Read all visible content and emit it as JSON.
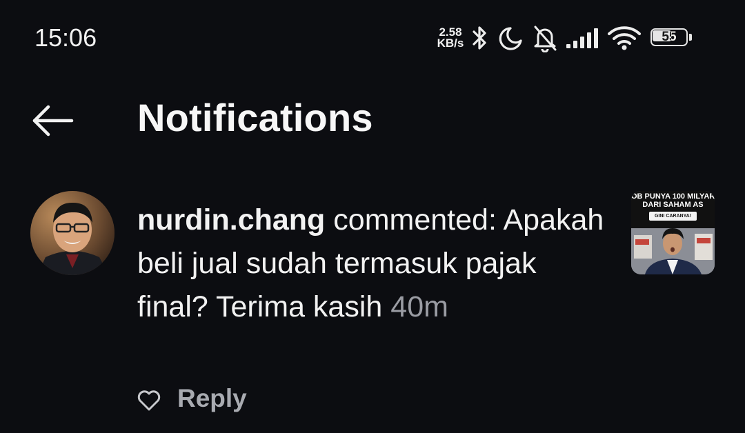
{
  "status_bar": {
    "time": "15:06",
    "net_speed_value": "2.58",
    "net_speed_unit": "KB/s",
    "battery_level": "55",
    "icons": [
      "bluetooth-icon",
      "moon-icon",
      "bell-muted-icon",
      "signal-icon",
      "wifi-icon",
      "battery-icon"
    ]
  },
  "header": {
    "title": "Notifications",
    "back_icon": "arrow-left-icon"
  },
  "notification": {
    "username": "nurdin.chang",
    "action": "commented:",
    "comment": "Apakah beli jual sudah termasuk pajak final? Terima kasih",
    "time": "40m",
    "thumbnail": {
      "line1": "OB PUNYA 100 MILYAR",
      "line2": "DARI SAHAM AS",
      "badge": "GINI CARANYA!"
    },
    "like_icon": "heart-outline-icon",
    "reply_label": "Reply"
  },
  "colors": {
    "background": "#0c0d11",
    "text_primary": "#f2f2f2",
    "text_secondary": "#9a9ca3",
    "reply_text": "#a9abb1"
  }
}
